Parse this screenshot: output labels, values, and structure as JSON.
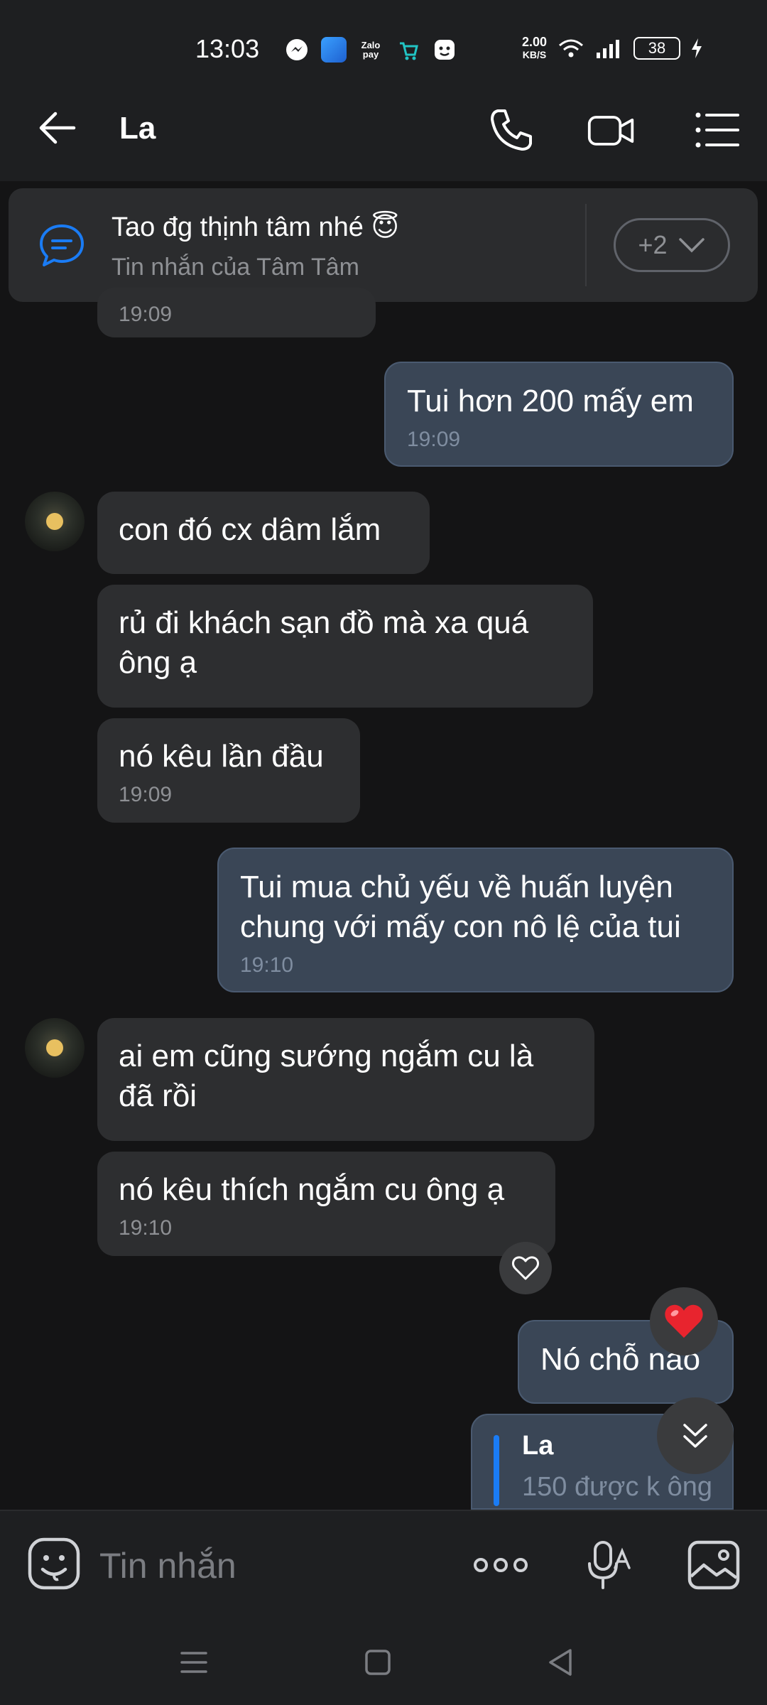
{
  "status": {
    "time": "13:03",
    "apps": [
      "messenger-icon",
      "browser-icon",
      "zalopay-icon",
      "shop-icon",
      "face-icon"
    ],
    "zalopay_label": "Zalo pay",
    "speed_value": "2.00",
    "speed_unit": "KB/S",
    "battery": "38"
  },
  "header": {
    "contact_name": "La"
  },
  "pinned": {
    "title": "Tao đg thịnh tâm nhé 😇",
    "subtitle": "Tin nhắn của Tâm Tâm",
    "more_label": "+2"
  },
  "messages": [
    {
      "id": "m0",
      "side": "in",
      "text": "",
      "time": "19:09"
    },
    {
      "id": "m1",
      "side": "out",
      "text": "Tui hơn 200 mấy em",
      "time": "19:09"
    },
    {
      "id": "m2",
      "side": "in",
      "text": "con đó cx dâm lắm",
      "time": ""
    },
    {
      "id": "m3",
      "side": "in",
      "text": "rủ đi khách sạn đồ mà xa quá ông ạ",
      "time": ""
    },
    {
      "id": "m4",
      "side": "in",
      "text": "nó kêu lần đầu",
      "time": "19:09"
    },
    {
      "id": "m5",
      "side": "out",
      "text": "Tui mua chủ yếu về huấn luyện chung với mấy con nô lệ của tui",
      "time": "19:10"
    },
    {
      "id": "m6",
      "side": "in",
      "text": "ai em cũng sướng ngắm cu là đã rồi",
      "time": ""
    },
    {
      "id": "m7",
      "side": "in",
      "text": "nó kêu thích ngắm cu ông ạ",
      "time": "19:10"
    },
    {
      "id": "m8",
      "side": "out",
      "text": "Nó chỗ nào",
      "time": ""
    }
  ],
  "quote": {
    "name": "La",
    "text": "150 được k ông"
  },
  "input": {
    "placeholder": "Tin nhắn"
  },
  "colors": {
    "accent": "#1a7cf5",
    "incoming": "#2d2e30",
    "outgoing": "#3a4656"
  }
}
